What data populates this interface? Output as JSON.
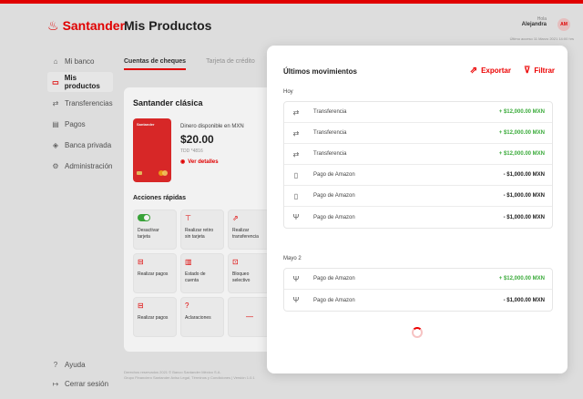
{
  "brand": {
    "name": "Santander",
    "accent": "#ec0000"
  },
  "sidebar": {
    "items": [
      {
        "label": "Mi banco",
        "icon": "bank-icon",
        "glyph": "⌂"
      },
      {
        "label": "Mis productos",
        "icon": "card-icon",
        "glyph": "▭",
        "active": true
      },
      {
        "label": "Transferencias",
        "icon": "transfer-icon",
        "glyph": "⇄"
      },
      {
        "label": "Pagos",
        "icon": "payments-icon",
        "glyph": "▤"
      },
      {
        "label": "Banca privada",
        "icon": "private-banking-icon",
        "glyph": "◈"
      },
      {
        "label": "Administración",
        "icon": "admin-icon",
        "glyph": "⚙"
      }
    ],
    "bottom": [
      {
        "label": "Ayuda",
        "icon": "help-icon",
        "glyph": "?"
      },
      {
        "label": "Cerrar sesión",
        "icon": "logout-icon",
        "glyph": "↦"
      }
    ]
  },
  "header": {
    "title": "Mis Productos",
    "greeting": "Hola",
    "user_name": "Alejandra",
    "avatar_initials": "AM",
    "last_access": "Último acceso 11 Marzo 2021 14:00 hrs"
  },
  "tabs": [
    {
      "label": "Cuentas de cheques",
      "active": true
    },
    {
      "label": "Tarjeta de crédito",
      "active": false
    }
  ],
  "account": {
    "name": "Santander clásica",
    "card_brand": "Santander",
    "balance_label": "Dinero disponible en MXN",
    "balance": "$20.00",
    "card_ref": "TDD *4816",
    "details_label": "Ver detalles"
  },
  "quick_actions": {
    "title": "Acciones rápidas",
    "items": [
      {
        "label": "Desactivar tarjeta",
        "icon": "toggle-icon"
      },
      {
        "label": "Realizar retiro sin tarjeta",
        "icon": "atm-icon",
        "glyph": "⊤"
      },
      {
        "label": "Realizar transferencia",
        "icon": "transfer-icon",
        "glyph": "⇗"
      },
      {
        "label": "Realizar pagos",
        "icon": "payment-icon",
        "glyph": "⊟"
      },
      {
        "label": "Estado de cuenta",
        "icon": "statement-icon",
        "glyph": "▥"
      },
      {
        "label": "Bloqueo selectivo",
        "icon": "lock-icon",
        "glyph": "⊡"
      },
      {
        "label": "Realizar pagos",
        "icon": "payment-icon",
        "glyph": "⊟"
      },
      {
        "label": "Aclaraciones",
        "icon": "question-icon",
        "glyph": "?"
      },
      {
        "label": "",
        "icon": "more-icon",
        "glyph": "—"
      }
    ]
  },
  "footer": {
    "line1": "Derechos reservados 2021 © Banco Santander México S.A.",
    "line2": "Grupo Financiero Santander Aviso Legal, Términos y Condiciones | Versión 1.0.1"
  },
  "movements": {
    "title": "Últimos movimientos",
    "export_label": "Exportar",
    "filter_label": "Filtrar",
    "groups": [
      {
        "label": "Hoy",
        "items": [
          {
            "name": "Transferencia",
            "amount": "+ $12,000.00 MXN",
            "type": "in",
            "icon": "transfer-icon",
            "glyph": "⇄"
          },
          {
            "name": "Transferencia",
            "amount": "+ $12,000.00 MXN",
            "type": "in",
            "icon": "transfer-icon",
            "glyph": "⇄"
          },
          {
            "name": "Transferencia",
            "amount": "+ $12,000.00 MXN",
            "type": "in",
            "icon": "transfer-icon",
            "glyph": "⇄"
          },
          {
            "name": "Pago de Amazon",
            "amount": "- $1,000.00 MXN",
            "type": "out",
            "icon": "shopping-icon",
            "glyph": "▯"
          },
          {
            "name": "Pago de Amazon",
            "amount": "- $1,000.00 MXN",
            "type": "out",
            "icon": "shopping-icon",
            "glyph": "▯"
          },
          {
            "name": "Pago de Amazon",
            "amount": "- $1,000.00 MXN",
            "type": "out",
            "icon": "restaurant-icon",
            "glyph": "Ψ"
          }
        ]
      },
      {
        "label": "Mayo 2",
        "items": [
          {
            "name": "Pago de Amazon",
            "amount": "+ $12,000.00 MXN",
            "type": "in",
            "icon": "restaurant-icon",
            "glyph": "Ψ"
          },
          {
            "name": "Pago de Amazon",
            "amount": "- $1,000.00 MXN",
            "type": "out",
            "icon": "restaurant-icon",
            "glyph": "Ψ"
          }
        ]
      }
    ]
  }
}
